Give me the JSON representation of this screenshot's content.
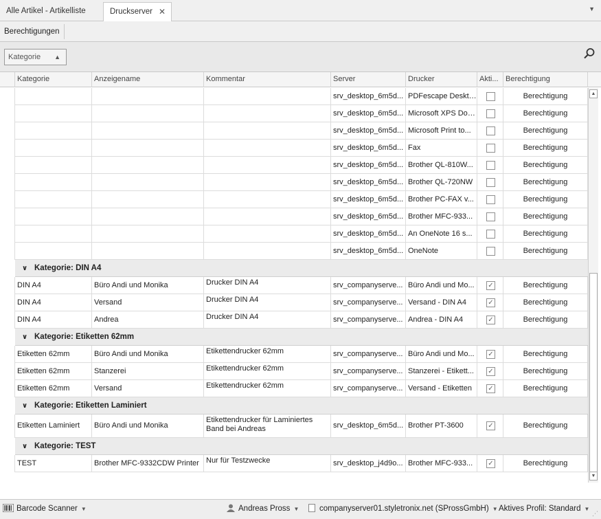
{
  "tabs": [
    {
      "label": "Alle Artikel - Artikelliste"
    },
    {
      "label": "Druckserver"
    }
  ],
  "ribbon": {
    "button": "Berechtigungen"
  },
  "grouppanel": {
    "chip": "Kategorie"
  },
  "columns": [
    "Kategorie",
    "Anzeigename",
    "Kommentar",
    "Server",
    "Drucker",
    "Akti...",
    "Berechtigung"
  ],
  "plain_rows": [
    {
      "server": "srv_desktop_6m5d...",
      "drucker": "PDFescape Desktop",
      "berechtigung": "Berechtigung"
    },
    {
      "server": "srv_desktop_6m5d...",
      "drucker": "Microsoft XPS Doc...",
      "berechtigung": "Berechtigung"
    },
    {
      "server": "srv_desktop_6m5d...",
      "drucker": "Microsoft Print to...",
      "berechtigung": "Berechtigung"
    },
    {
      "server": "srv_desktop_6m5d...",
      "drucker": "Fax",
      "berechtigung": "Berechtigung"
    },
    {
      "server": "srv_desktop_6m5d...",
      "drucker": "Brother QL-810W...",
      "berechtigung": "Berechtigung"
    },
    {
      "server": "srv_desktop_6m5d...",
      "drucker": "Brother QL-720NW",
      "berechtigung": "Berechtigung"
    },
    {
      "server": "srv_desktop_6m5d...",
      "drucker": "Brother PC-FAX v...",
      "berechtigung": "Berechtigung"
    },
    {
      "server": "srv_desktop_6m5d...",
      "drucker": "Brother MFC-933...",
      "berechtigung": "Berechtigung"
    },
    {
      "server": "srv_desktop_6m5d...",
      "drucker": "An OneNote 16 s...",
      "berechtigung": "Berechtigung"
    },
    {
      "server": "srv_desktop_6m5d...",
      "drucker": "OneNote",
      "berechtigung": "Berechtigung"
    }
  ],
  "groups": [
    {
      "title": "Kategorie: DIN A4",
      "rows": [
        {
          "kategorie": "DIN A4",
          "anzeigename": "Büro Andi und Monika",
          "kommentar": "Drucker DIN A4",
          "server": "srv_companyserve...",
          "drucker": "Büro Andi und Mo...",
          "berechtigung": "Berechtigung"
        },
        {
          "kategorie": "DIN A4",
          "anzeigename": "Versand",
          "kommentar": "Drucker DIN A4",
          "server": "srv_companyserve...",
          "drucker": "Versand - DIN A4",
          "berechtigung": "Berechtigung"
        },
        {
          "kategorie": "DIN A4",
          "anzeigename": "Andrea",
          "kommentar": "Drucker DIN A4",
          "server": "srv_companyserve...",
          "drucker": "Andrea - DIN A4",
          "berechtigung": "Berechtigung"
        }
      ]
    },
    {
      "title": "Kategorie: Etiketten 62mm",
      "rows": [
        {
          "kategorie": "Etiketten 62mm",
          "anzeigename": "Büro Andi und Monika",
          "kommentar": "Etikettendrucker 62mm",
          "server": "srv_companyserve...",
          "drucker": "Büro Andi und Mo...",
          "berechtigung": "Berechtigung"
        },
        {
          "kategorie": "Etiketten 62mm",
          "anzeigename": "Stanzerei",
          "kommentar": "Etikettendrucker 62mm",
          "server": "srv_companyserve...",
          "drucker": "Stanzerei - Etikett...",
          "berechtigung": "Berechtigung"
        },
        {
          "kategorie": "Etiketten 62mm",
          "anzeigename": "Versand",
          "kommentar": "Etikettendrucker 62mm",
          "server": "srv_companyserve...",
          "drucker": "Versand - Etiketten",
          "berechtigung": "Berechtigung"
        }
      ]
    },
    {
      "title": "Kategorie: Etiketten Laminiert",
      "rows": [
        {
          "kategorie": "Etiketten Laminiert",
          "anzeigename": "Büro Andi und Monika",
          "kommentar": "Etikettendrucker für Laminiertes Band bei Andreas",
          "server": "srv_desktop_6m5d...",
          "drucker": "Brother PT-3600",
          "berechtigung": "Berechtigung"
        }
      ]
    },
    {
      "title": "Kategorie: TEST",
      "rows": [
        {
          "kategorie": "TEST",
          "anzeigename": "Brother MFC-9332CDW Printer",
          "kommentar": "Nur für Testzwecke",
          "server": "srv_desktop_j4d9o...",
          "drucker": "Brother MFC-933...",
          "berechtigung": "Berechtigung"
        }
      ]
    }
  ],
  "status": {
    "scanner": "Barcode Scanner",
    "user": "Andreas Pross",
    "server": "companyserver01.styletronix.net (SProssGmbH)",
    "profile": "Aktives Profil: Standard"
  }
}
